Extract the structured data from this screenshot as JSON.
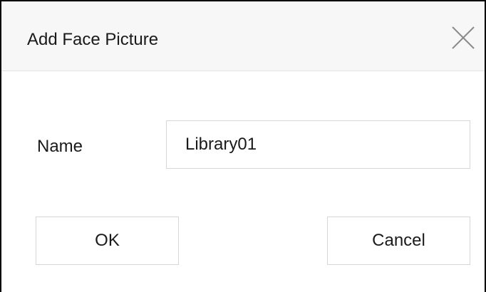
{
  "dialog": {
    "title": "Add Face Picture",
    "close_icon": "close-icon"
  },
  "form": {
    "name_label": "Name",
    "name_value": "Library01"
  },
  "buttons": {
    "ok_label": "OK",
    "cancel_label": "Cancel"
  }
}
